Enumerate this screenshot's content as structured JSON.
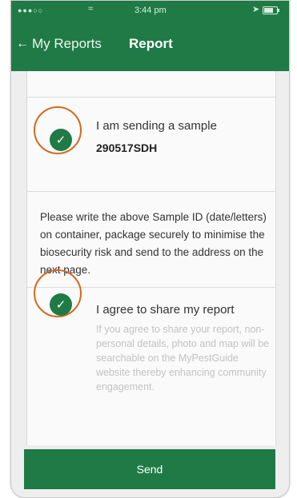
{
  "status_bar": {
    "signal": "●●●○○",
    "wifi_icon": "wifi-icon",
    "time": "3:44 pm",
    "location_icon": "location-arrow-icon",
    "battery_icon": "battery-icon"
  },
  "nav": {
    "back_label": "My Reports",
    "title": "Report"
  },
  "sample": {
    "checked": true,
    "label": "I am sending a sample",
    "id": "290517SDH"
  },
  "instructions": "Please write the above Sample ID (date/letters) on container, package securely to minimise the biosecurity risk and send to the address on the next page.",
  "share": {
    "checked": true,
    "label": "I agree to share my report",
    "description": "If you agree to share your report, non-personal details, photo and map will be searchable on the MyPestGuide website thereby enhancing community engagement."
  },
  "send_label": "Send",
  "colors": {
    "brand_green": "#1f7a46",
    "highlight_ring": "#d2691e"
  }
}
